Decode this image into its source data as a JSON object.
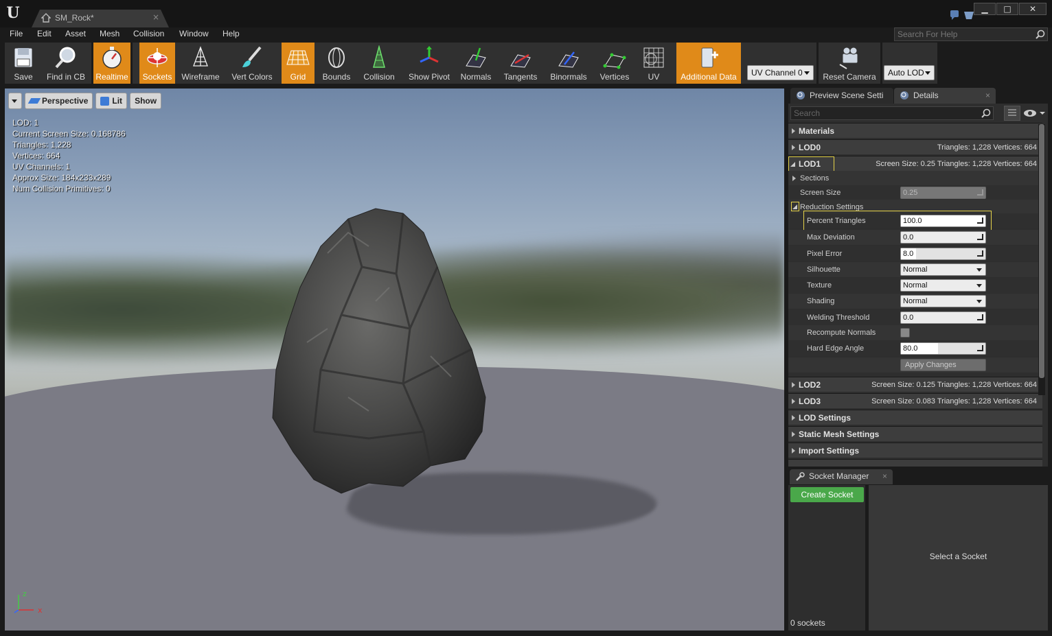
{
  "window": {
    "tab_title": "SM_Rock*",
    "tab_close": "×",
    "minimize": "▁",
    "maximize": "□",
    "close": "✕"
  },
  "menu": [
    "File",
    "Edit",
    "Asset",
    "Mesh",
    "Collision",
    "Window",
    "Help"
  ],
  "help_search": {
    "placeholder": "Search For Help"
  },
  "toolbar": {
    "save": "Save",
    "find_in_cb": "Find in CB",
    "realtime": "Realtime",
    "sockets": "Sockets",
    "wireframe": "Wireframe",
    "vert_colors": "Vert Colors",
    "grid": "Grid",
    "bounds": "Bounds",
    "collision": "Collision",
    "show_pivot": "Show Pivot",
    "normals": "Normals",
    "tangents": "Tangents",
    "binormals": "Binormals",
    "vertices": "Vertices",
    "uv": "UV",
    "additional_data": "Additional Data",
    "uv_channel": "UV Channel 0",
    "reset_camera": "Reset Camera",
    "auto_lod": "Auto LOD"
  },
  "viewport": {
    "perspective": "Perspective",
    "lit": "Lit",
    "show": "Show",
    "stats": [
      "LOD:  1",
      "Current Screen Size:  0.168786",
      "Triangles:  1,228",
      "Vertices:  664",
      "UV Channels:  1",
      "Approx Size: 184x233x289",
      "Num Collision Primitives:  0"
    ],
    "axis_z": "z",
    "axis_x": "x"
  },
  "details": {
    "tab_preview": "Preview Scene Setti",
    "tab_details": "Details",
    "search_placeholder": "Search",
    "materials": "Materials",
    "lod0": {
      "label": "LOD0",
      "info": "Triangles: 1,228    Vertices: 664"
    },
    "lod1": {
      "label": "LOD1",
      "info": "Screen Size: 0.25    Triangles: 1,228    Vertices: 664"
    },
    "sections": "Sections",
    "screen_size": {
      "label": "Screen Size",
      "value": "0.25"
    },
    "reduction_settings": "Reduction Settings",
    "percent_triangles": {
      "label": "Percent Triangles",
      "value": "100.0"
    },
    "max_deviation": {
      "label": "Max Deviation",
      "value": "0.0"
    },
    "pixel_error": {
      "label": "Pixel Error",
      "value": "8.0"
    },
    "silhouette": {
      "label": "Silhouette",
      "value": "Normal"
    },
    "texture": {
      "label": "Texture",
      "value": "Normal"
    },
    "shading": {
      "label": "Shading",
      "value": "Normal"
    },
    "welding_threshold": {
      "label": "Welding Threshold",
      "value": "0.0"
    },
    "recompute_normals": {
      "label": "Recompute Normals",
      "checked": false
    },
    "hard_edge_angle": {
      "label": "Hard Edge Angle",
      "value": "80.0"
    },
    "apply_changes": "Apply Changes",
    "lod2": {
      "label": "LOD2",
      "info": "Screen Size: 0.125    Triangles: 1,228    Vertices: 664"
    },
    "lod3": {
      "label": "LOD3",
      "info": "Screen Size: 0.083    Triangles: 1,228    Vertices: 664"
    },
    "lod_settings": "LOD Settings",
    "static_mesh_settings": "Static Mesh Settings",
    "import_settings": "Import Settings"
  },
  "socket_manager": {
    "tab": "Socket Manager",
    "create_socket": "Create Socket",
    "count": "0 sockets",
    "select_socket": "Select a Socket"
  },
  "colors": {
    "accent_orange": "#e08a19",
    "create_green": "#4aa84a",
    "highlight_yellow": "#e6d44a"
  }
}
